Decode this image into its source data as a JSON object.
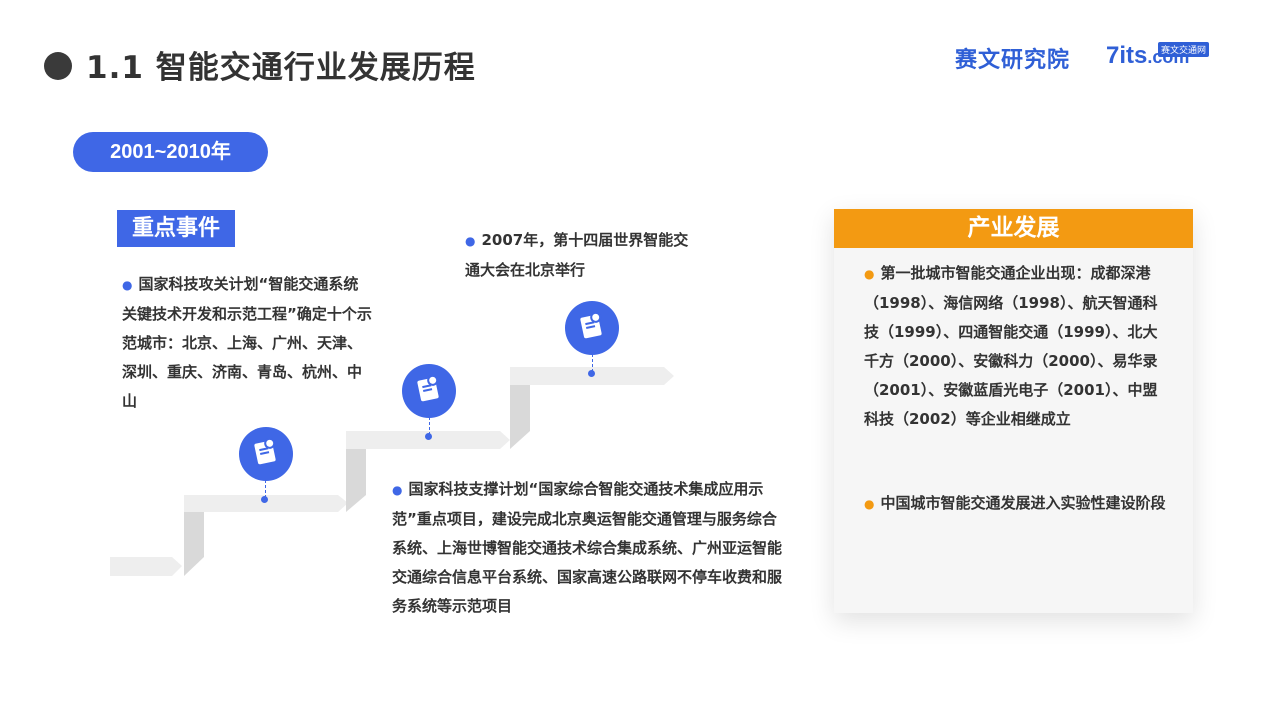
{
  "header": {
    "title": "1.1 智能交通行业发展历程",
    "brand_cn": "赛文研究院",
    "brand_en_num": "7",
    "brand_en_mid": "its",
    "brand_en_dom": ".com",
    "brand_tag": "赛文交通网"
  },
  "period": "2001~2010年",
  "key_events": {
    "label": "重点事件",
    "event1": "国家科技攻关计划“智能交通系统关键技术开发和示范工程”确定十个示范城市：北京、上海、广州、天津、深圳、重庆、济南、青岛、杭州、中山",
    "event2": "2007年，第十四届世界智能交通大会在北京举行",
    "event3": "国家科技支撑计划“国家综合智能交通技术集成应用示范”重点项目，建设完成北京奥运智能交通管理与服务综合系统、上海世博智能交通技术综合集成系统、广州亚运智能交通综合信息平台系统、国家高速公路联网不停车收费和服务系统等示范项目"
  },
  "industry": {
    "label": "产业发展",
    "item1": "第一批城市智能交通企业出现：成都深港（1998）、海信网络（1998）、航天智通科技（1999）、四通智能交通（1999）、北大千方（2000）、安徽科力（2000）、易华录（2001）、安徽蓝盾光电子（2001）、中盟科技（2002）等企业相继成立",
    "item2": "中国城市智能交通发展进入实验性建设阶段"
  },
  "colors": {
    "accent_blue": "#3f67e6",
    "accent_orange": "#f39a12",
    "title_dark": "#333333"
  },
  "icons": [
    "note-icon",
    "note-icon",
    "note-icon"
  ]
}
